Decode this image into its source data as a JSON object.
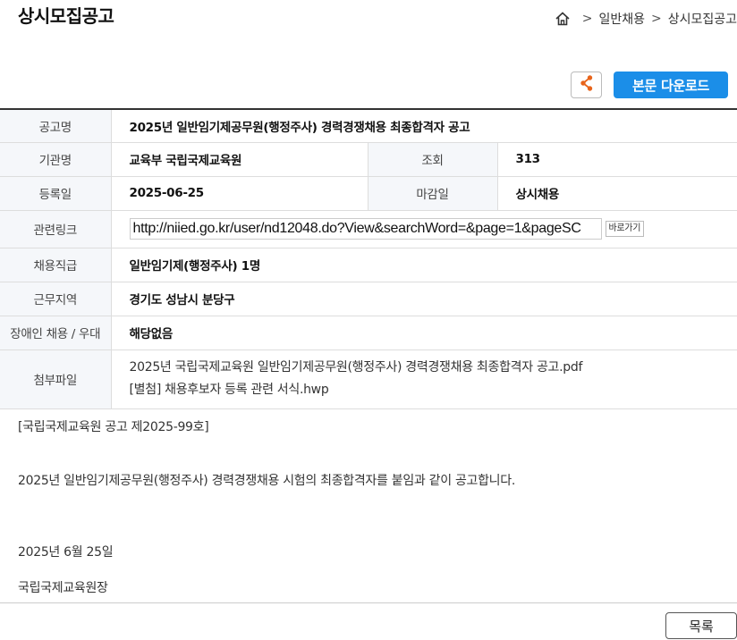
{
  "page_title": "상시모집공고",
  "breadcrumb": {
    "items": [
      "일반채용",
      "상시모집공고"
    ],
    "separator": ">"
  },
  "actions": {
    "share_icon": "share-icon",
    "download_label": "본문 다운로드"
  },
  "info": {
    "title_label": "공고명",
    "title_value": "2025년 일반임기제공무원(행정주사) 경력경쟁채용 최종합격자 공고",
    "org_label": "기관명",
    "org_value": "교육부 국립국제교육원",
    "views_label": "조회",
    "views_value": "313",
    "reg_label": "등록일",
    "reg_value": "2025-06-25",
    "deadline_label": "마감일",
    "deadline_value": "상시채용",
    "link_label": "관련링크",
    "link_value": "http://niied.go.kr/user/nd12048.do?View&searchWord=&page=1&pageSC",
    "link_button": "바로가기",
    "position_label": "채용직급",
    "position_value": "일반임기제(행정주사) 1명",
    "location_label": "근무지역",
    "location_value": "경기도 성남시 분당구",
    "disabled_label": "장애인 채용 / 우대",
    "disabled_value": "해당없음",
    "attach_label": "첨부파일",
    "attachments": [
      "2025년 국립국제교육원 일반임기제공무원(행정주사) 경력경쟁채용 최종합격자 공고.pdf",
      "[별첨] 채용후보자 등록 관련 서식.hwp"
    ]
  },
  "body": {
    "line1": "[국립국제교육원 공고 제2025-99호]",
    "line2": "2025년 일반임기제공무원(행정주사) 경력경쟁채용 시험의 최종합격자를 붙임과 같이 공고합니다.",
    "date": "2025년 6월 25일",
    "signer": "국립국제교육원장"
  },
  "list_button": "목록"
}
